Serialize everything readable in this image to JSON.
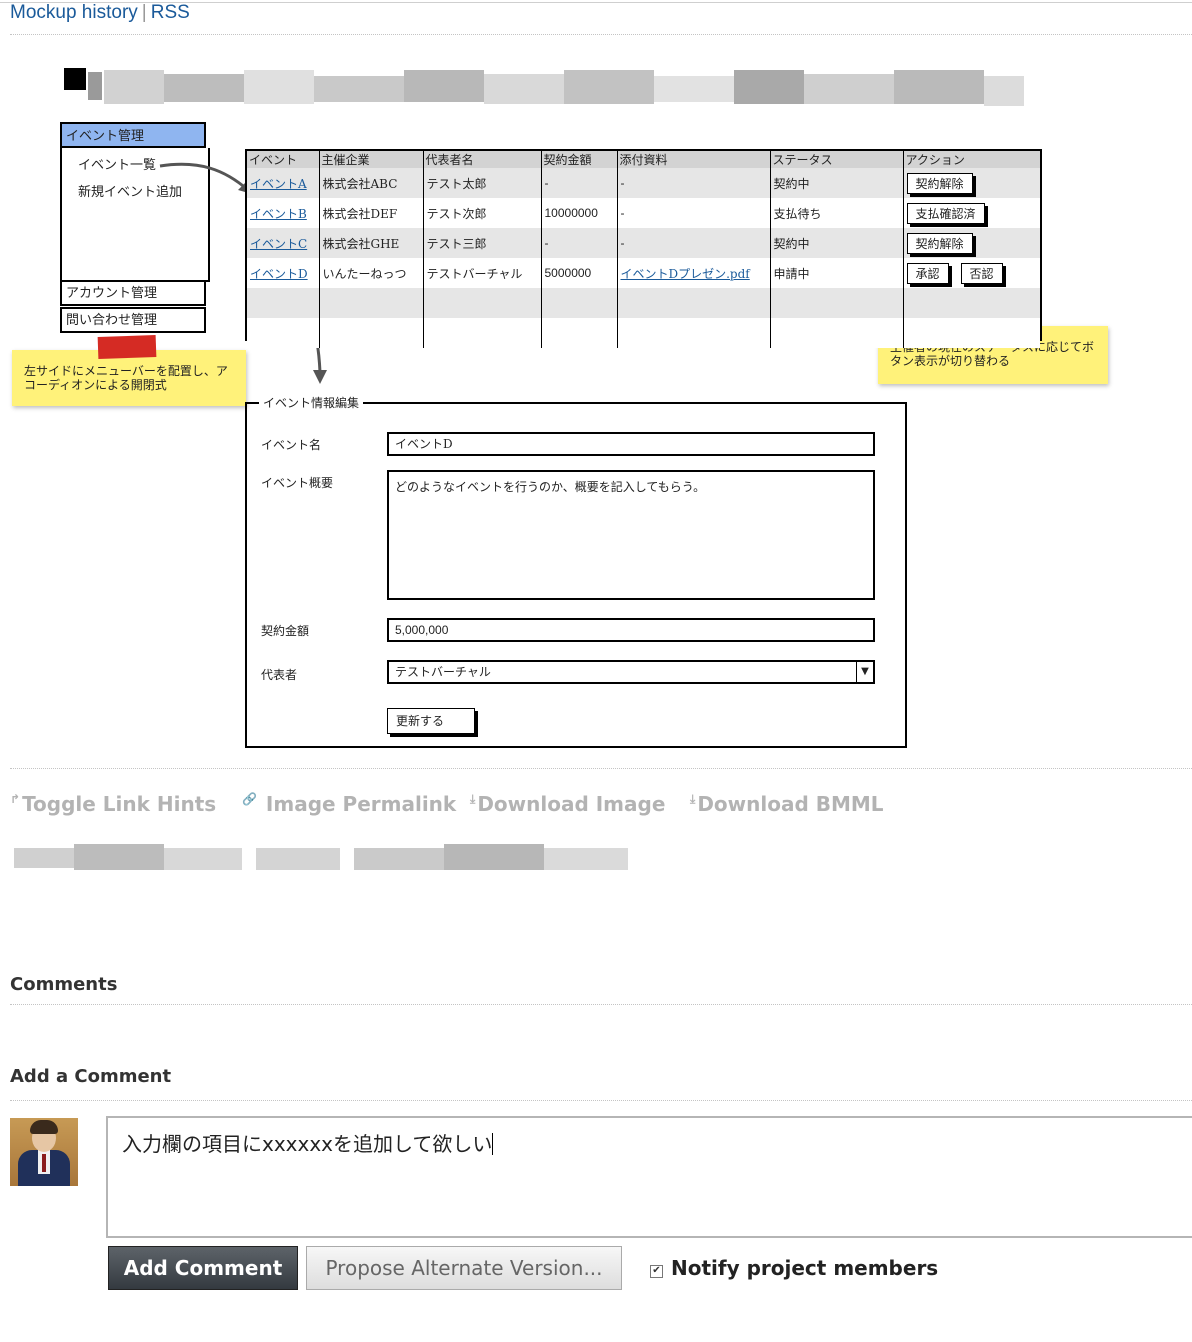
{
  "header": {
    "mockup_history": "Mockup history",
    "separator": "|",
    "rss": "RSS"
  },
  "mockup": {
    "menu": {
      "section_active": "イベント管理",
      "items": [
        "イベント一覧",
        "新規イベント追加"
      ],
      "section_account": "アカウント管理",
      "section_inquiry": "問い合わせ管理"
    },
    "note_left": "左サイドにメニューバーを配置し、アコーディオンによる開閉式",
    "note_right": "主催者の現在のステータスに応じてボタン表示が切り替わる",
    "grid": {
      "headers": [
        "イベント",
        "主催企業",
        "代表者名",
        "契約金額",
        "添付資料",
        "ステータス",
        "アクション"
      ],
      "rows": [
        {
          "event": "イベントA",
          "company": "株式会社ABC",
          "rep": "テスト太郎",
          "amount": "-",
          "file": "-",
          "status": "契約中",
          "actions": [
            "契約解除"
          ]
        },
        {
          "event": "イベントB",
          "company": "株式会社DEF",
          "rep": "テスト次郎",
          "amount": "10000000",
          "file": "-",
          "status": "支払待ち",
          "actions": [
            "支払確認済"
          ]
        },
        {
          "event": "イベントC",
          "company": "株式会社GHE",
          "rep": "テスト三郎",
          "amount": "-",
          "file": "-",
          "status": "契約中",
          "actions": [
            "契約解除"
          ]
        },
        {
          "event": "イベントD",
          "company": "いんたーねっつ",
          "rep": "テストバーチャル",
          "amount": "5000000",
          "file": "イベントDプレゼン.pdf",
          "status": "申請中",
          "actions": [
            "承認",
            "否認"
          ]
        }
      ]
    },
    "form": {
      "legend": "イベント情報編集",
      "name_label": "イベント名",
      "name_value": "イベントD",
      "summary_label": "イベント概要",
      "summary_value": "どのようなイベントを行うのか、概要を記入してもらう。",
      "amount_label": "契約金額",
      "amount_value": "5,000,000",
      "rep_label": "代表者",
      "rep_value": "テストバーチャル",
      "submit": "更新する"
    }
  },
  "actions": {
    "toggle_link_hints": "Toggle Link Hints",
    "image_permalink": "Image Permalink",
    "download_image": "Download Image",
    "download_bmml": "Download BMML"
  },
  "comments": {
    "heading": "Comments",
    "add_heading": "Add a Comment",
    "textarea_value": "入力欄の項目にxxxxxxを追加して欲しい",
    "add_button": "Add Comment",
    "propose_button": "Propose Alternate Version...",
    "notify_label": "Notify project members",
    "notify_checked": true
  }
}
